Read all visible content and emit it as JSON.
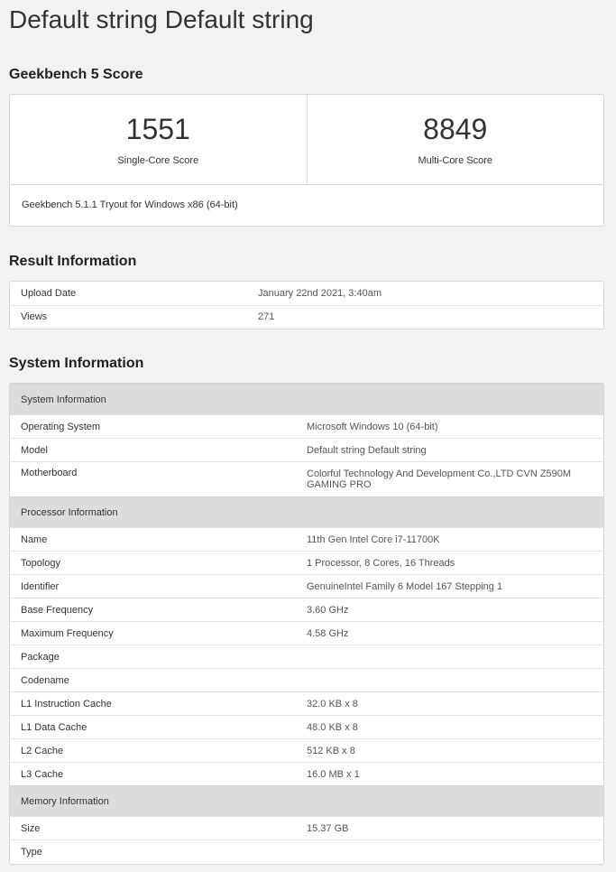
{
  "title": "Default string Default string",
  "score_section": {
    "heading": "Geekbench 5 Score",
    "single_core_value": "1551",
    "single_core_label": "Single-Core Score",
    "multi_core_value": "8849",
    "multi_core_label": "Multi-Core Score",
    "version": "Geekbench 5.1.1 Tryout for Windows x86 (64-bit)"
  },
  "result_section": {
    "heading": "Result Information",
    "rows": [
      {
        "key": "Upload Date",
        "value": "January 22nd 2021, 3:40am"
      },
      {
        "key": "Views",
        "value": "271"
      }
    ]
  },
  "system_section": {
    "heading": "System Information",
    "groups": [
      {
        "title": "System Information",
        "rows": [
          {
            "key": "Operating System",
            "value": "Microsoft Windows 10 (64-bit)"
          },
          {
            "key": "Model",
            "value": "Default string Default string"
          },
          {
            "key": "Motherboard",
            "value": "Colorful Technology And Development Co.,LTD CVN Z590M GAMING PRO"
          }
        ]
      },
      {
        "title": "Processor Information",
        "rows": [
          {
            "key": "Name",
            "value": "11th Gen Intel Core i7-11700K"
          },
          {
            "key": "Topology",
            "value": "1 Processor, 8 Cores, 16 Threads"
          },
          {
            "key": "Identifier",
            "value": "GenuineIntel Family 6 Model 167 Stepping 1"
          },
          {
            "key": "Base Frequency",
            "value": "3.60 GHz"
          },
          {
            "key": "Maximum Frequency",
            "value": "4.58 GHz"
          },
          {
            "key": "Package",
            "value": ""
          },
          {
            "key": "Codename",
            "value": ""
          },
          {
            "key": "L1 Instruction Cache",
            "value": "32.0 KB x 8"
          },
          {
            "key": "L1 Data Cache",
            "value": "48.0 KB x 8"
          },
          {
            "key": "L2 Cache",
            "value": "512 KB x 8"
          },
          {
            "key": "L3 Cache",
            "value": "16.0 MB x 1"
          }
        ]
      },
      {
        "title": "Memory Information",
        "rows": [
          {
            "key": "Size",
            "value": "15.37 GB"
          },
          {
            "key": "Type",
            "value": ""
          }
        ]
      }
    ]
  }
}
